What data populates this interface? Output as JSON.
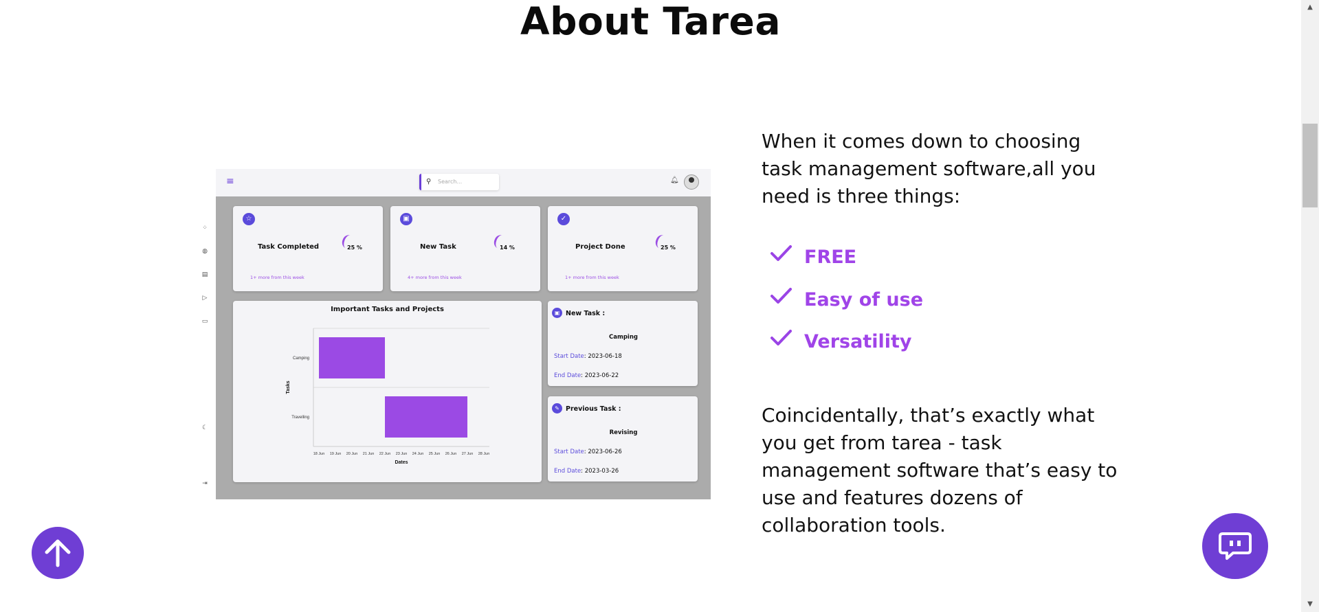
{
  "heading": "About Tarea",
  "preview": {
    "search_placeholder": "Search...",
    "stats": [
      {
        "label": "Task Completed",
        "percent": "25 %",
        "note": "1+ more from this week"
      },
      {
        "label": "New Task",
        "percent": "14 %",
        "note": "4+ more from this week"
      },
      {
        "label": "Project Done",
        "percent": "25 %",
        "note": "1+ more from this week"
      }
    ],
    "chart_title": "Important Tasks and Projects",
    "new_task": {
      "heading": "New Task :",
      "name": "Camping",
      "start_label": "Start Date",
      "start": ": 2023-06-18",
      "end_label": "End Date",
      "end": ": 2023-06-22"
    },
    "previous_task": {
      "heading": "Previous Task :",
      "name": "Revising",
      "start_label": "Start Date",
      "start": ": 2023-06-26",
      "end_label": "End Date",
      "end": ": 2023-03-26"
    }
  },
  "chart_data": {
    "type": "bar",
    "title": "Important Tasks and Projects",
    "xlabel": "Dates",
    "ylabel": "Tasks",
    "x_ticks": [
      "18 Jun",
      "19 Jun",
      "20 Jun",
      "21 Jun",
      "22 Jun",
      "23 Jun",
      "24 Jun",
      "25 Jun",
      "26 Jun",
      "27 Jun",
      "28 Jun"
    ],
    "categories": [
      "Camping",
      "Travelling"
    ],
    "ranges": [
      {
        "task": "Camping",
        "start": "18 Jun",
        "end": "22 Jun"
      },
      {
        "task": "Travelling",
        "start": "22 Jun",
        "end": "27 Jun"
      }
    ],
    "color": "#9b4ae4",
    "orientation": "horizontal"
  },
  "intro": "When it comes down to choosing task management software,all you need is three things:",
  "features": [
    "FREE",
    "Easy of use",
    "Versatility"
  ],
  "outro": "Coincidentally, that’s exactly what you get from tarea - task management software that’s easy to use and features dozens of collaboration tools.",
  "accent": "#a044e8",
  "button_color": "#6f3ed4"
}
